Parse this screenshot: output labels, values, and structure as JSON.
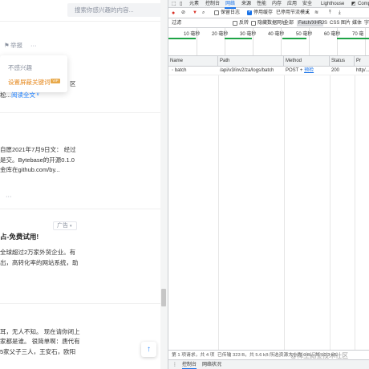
{
  "page": {
    "search_placeholder": "搜索你感兴趣的内容...",
    "report_label": "举报",
    "more_dots": "···",
    "popup": {
      "not_interested": "不感兴趣",
      "block_keywords": "设置屏蔽关键词",
      "vip": "VIP"
    },
    "article1": {
      "tail_chars": "区",
      "snippet": "松...",
      "read_full": "阅读全文",
      "chevron": "∨"
    },
    "article2": {
      "line1": "自愿2021年7月9日文：  经过",
      "line2": "是交。Bytebase的开源0.1.0",
      "line3": "金库在github.com/by...",
      "more_dots": "···"
    },
    "ad": {
      "badge": "广告",
      "title": "占-免费试用!",
      "line1": "全球超过2万家外贸企业。有",
      "line2": "出，高转化率的网站系统，助"
    },
    "article3": {
      "line1": "耳，无人不知。 现在请你闭上",
      "line2": "家都是谁。 很简单啊：唐代有",
      "line3": "5家父子三人，王安石，欧阳"
    },
    "back_to_top": "↑"
  },
  "devtools": {
    "tabs": [
      "元素",
      "控制台",
      "网络",
      "来源",
      "性能",
      "内存",
      "应用",
      "安全",
      "Lighthouse",
      "Comp"
    ],
    "active_tab": "网络",
    "toolbar": {
      "preserve_log": "保留日志",
      "disable_cache": "停用缓存",
      "throttle": "已停用节流模式",
      "dropdown": "▾"
    },
    "filter": {
      "label": "过滤",
      "invert": "反转",
      "hide_data_urls": "隐藏数据网址",
      "types": [
        "全部",
        "Fetch/XHR",
        "JS",
        "CSS",
        "图片",
        "媒体",
        "字"
      ],
      "selected": "Fetch/XHR"
    },
    "timeline": {
      "ticks": [
        "10 毫秒",
        "20 毫秒",
        "30 毫秒",
        "40 毫秒",
        "50 毫秒",
        "60 毫秒",
        "70 毫"
      ]
    },
    "table": {
      "columns": [
        "Name",
        "Path",
        "Method",
        "Status",
        "Pr"
      ],
      "rows": [
        {
          "name": "batch",
          "path": "/api/v3/inv2/za/logs/batch",
          "method": "POST",
          "method_link": "预检",
          "status": "200",
          "protocol": "http/..."
        }
      ]
    },
    "status": {
      "requests": "第 1 项请求，共 4 项",
      "transferred": "已传输 323 B，共 5.6 kB",
      "resources": "所选资源大小为 0 B，共 10.3 kB"
    },
    "drawer": {
      "console": "控制台",
      "network_conditions": "网络状况",
      "close": "×"
    }
  },
  "watermark": "@稀土掘金技术社区",
  "colors": {
    "accent": "#1e80ff",
    "devtools_blue": "#1a73e8",
    "record_red": "#d93025",
    "vip_gold": "#e8a94a",
    "timeline_green": "#1ea446"
  }
}
